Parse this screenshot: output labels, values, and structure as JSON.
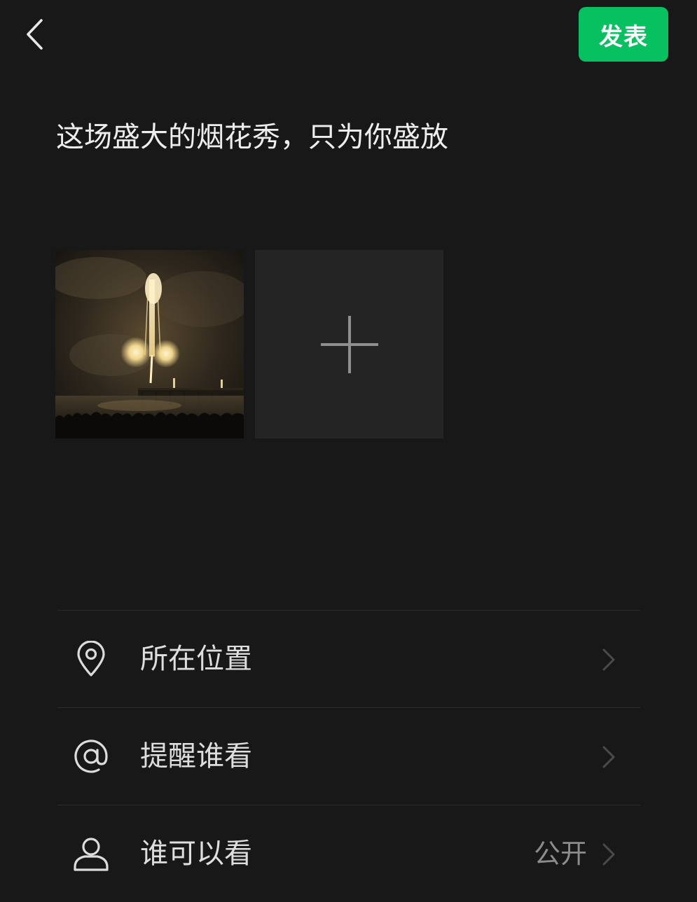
{
  "header": {
    "back_icon": "chevron-left-icon",
    "publish_label": "发表",
    "publish_color": "#07c160"
  },
  "post": {
    "text": "这场盛大的烟花秀，只为你盛放"
  },
  "media": {
    "photo": "fireworks-over-pier-photo",
    "add_icon": "plus-icon"
  },
  "options": [
    {
      "label": "所在位置",
      "icon": "location-pin-icon",
      "value": ""
    },
    {
      "label": "提醒谁看",
      "icon": "at-sign-icon",
      "value": ""
    },
    {
      "label": "谁可以看",
      "icon": "person-icon",
      "value": "公开"
    }
  ],
  "colors": {
    "background": "#181818",
    "accent": "#07c160",
    "text": "#eeeeee",
    "secondary_text": "#8c8c8c"
  }
}
